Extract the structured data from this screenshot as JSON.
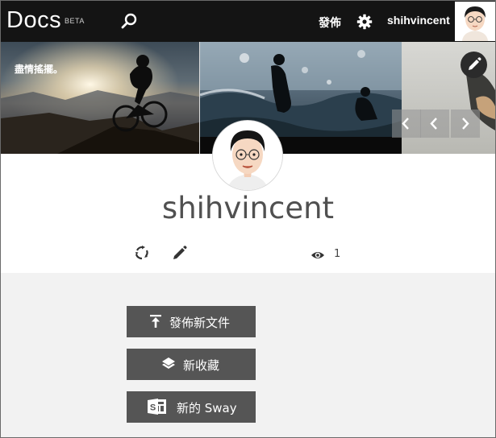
{
  "topbar": {
    "logo": "Docs",
    "beta": "BETA",
    "publish_label": "發佈",
    "username": "shihvincent"
  },
  "cover": {
    "caption": "盡情搖擺。"
  },
  "profile": {
    "name": "shihvincent",
    "views": "1"
  },
  "actions": {
    "publish_new": "發佈新文件",
    "new_collection": "新收藏",
    "new_sway": "新的 Sway"
  },
  "colors": {
    "topbar": "#141414",
    "button": "#555555",
    "content_bg": "#f2f2f2"
  },
  "icons": [
    "search-icon",
    "gear-icon",
    "pencil-icon",
    "chevron-left-icon",
    "chevron-right-icon",
    "sync-icon",
    "eye-icon",
    "upload-icon",
    "layers-icon",
    "sway-icon"
  ]
}
